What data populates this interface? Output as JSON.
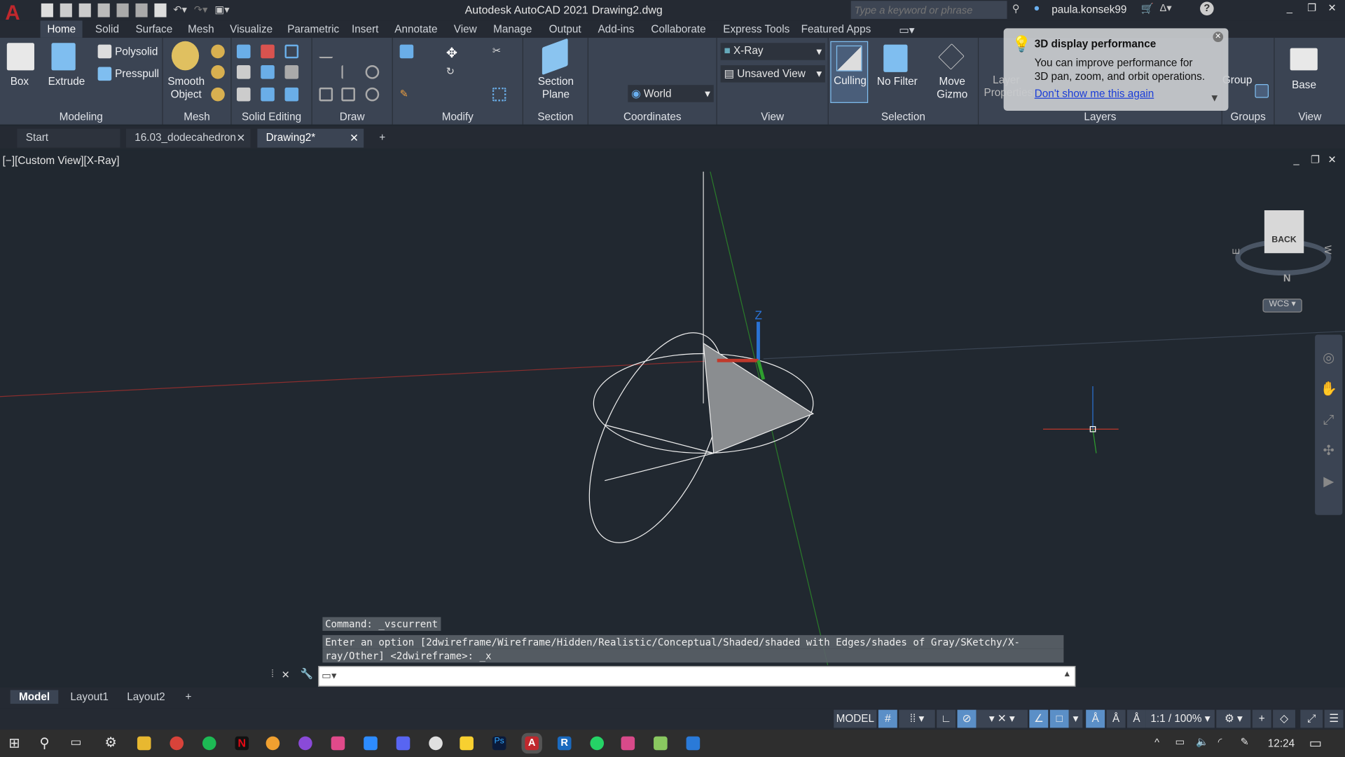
{
  "titlebar": {
    "app_title": "Autodesk AutoCAD 2021",
    "file": "Drawing2.dwg",
    "search_placeholder": "Type a keyword or phrase",
    "user": "paula.konsek99"
  },
  "ribbon_tabs": [
    "Home",
    "Solid",
    "Surface",
    "Mesh",
    "Visualize",
    "Parametric",
    "Insert",
    "Annotate",
    "View",
    "Manage",
    "Output",
    "Add-ins",
    "Collaborate",
    "Express Tools",
    "Featured Apps"
  ],
  "ribbon": {
    "modeling": {
      "title": "Modeling",
      "box": "Box",
      "extrude": "Extrude",
      "polysolid": "Polysolid",
      "presspull": "Presspull"
    },
    "mesh": {
      "title": "Mesh",
      "smooth_object": "Smooth Object"
    },
    "solid_editing": {
      "title": "Solid Editing"
    },
    "draw": {
      "title": "Draw"
    },
    "modify": {
      "title": "Modify"
    },
    "section": {
      "title": "Section",
      "section_plane": "Section Plane"
    },
    "coordinates": {
      "title": "Coordinates",
      "ucs": "World"
    },
    "view": {
      "title": "View",
      "visual_style": "X-Ray",
      "named_view": "Unsaved View"
    },
    "selection": {
      "title": "Selection",
      "culling": "Culling",
      "no_filter": "No Filter",
      "move_gizmo": "Move Gizmo"
    },
    "layers": {
      "title": "Layers",
      "layer_properties": "Layer Properties"
    },
    "groups": {
      "title": "Groups",
      "group": "Group"
    },
    "view2": {
      "title": "View",
      "base": "Base"
    }
  },
  "tooltip": {
    "title": "3D display performance",
    "body": "You can improve performance for 3D pan, zoom, and orbit operations.",
    "link": "Don't show me this again"
  },
  "doc_tabs": [
    {
      "label": "Start"
    },
    {
      "label": "16.03_dodecahedron"
    },
    {
      "label": "Drawing2*"
    }
  ],
  "viewport": {
    "label": "[−][Custom View][X-Ray]",
    "viewcube": "BACK",
    "compass_n": "N",
    "compass_w": "W",
    "compass_e": "E",
    "wcs": "WCS",
    "ucs_z": "Z"
  },
  "command": {
    "history1": "Command: _vscurrent",
    "history2": "Enter an option [2dwireframe/Wireframe/Hidden/Realistic/Conceptual/Shaded/shaded with Edges/shades of Gray/SKetchy/X-",
    "history3": "ray/Other] <2dwireframe>: _x",
    "input": ""
  },
  "layout_tabs": [
    "Model",
    "Layout1",
    "Layout2"
  ],
  "status": {
    "model": "MODEL",
    "scale": "1:1 / 100%"
  },
  "taskbar": {
    "time": "12:24"
  },
  "colors": {
    "ribbon_bg": "#3b4453",
    "canvas_bg": "#212830",
    "accent": "#5b8fc7",
    "x_axis": "#c0392b",
    "y_axis": "#2e9e2e",
    "z_axis": "#2a72d4"
  }
}
